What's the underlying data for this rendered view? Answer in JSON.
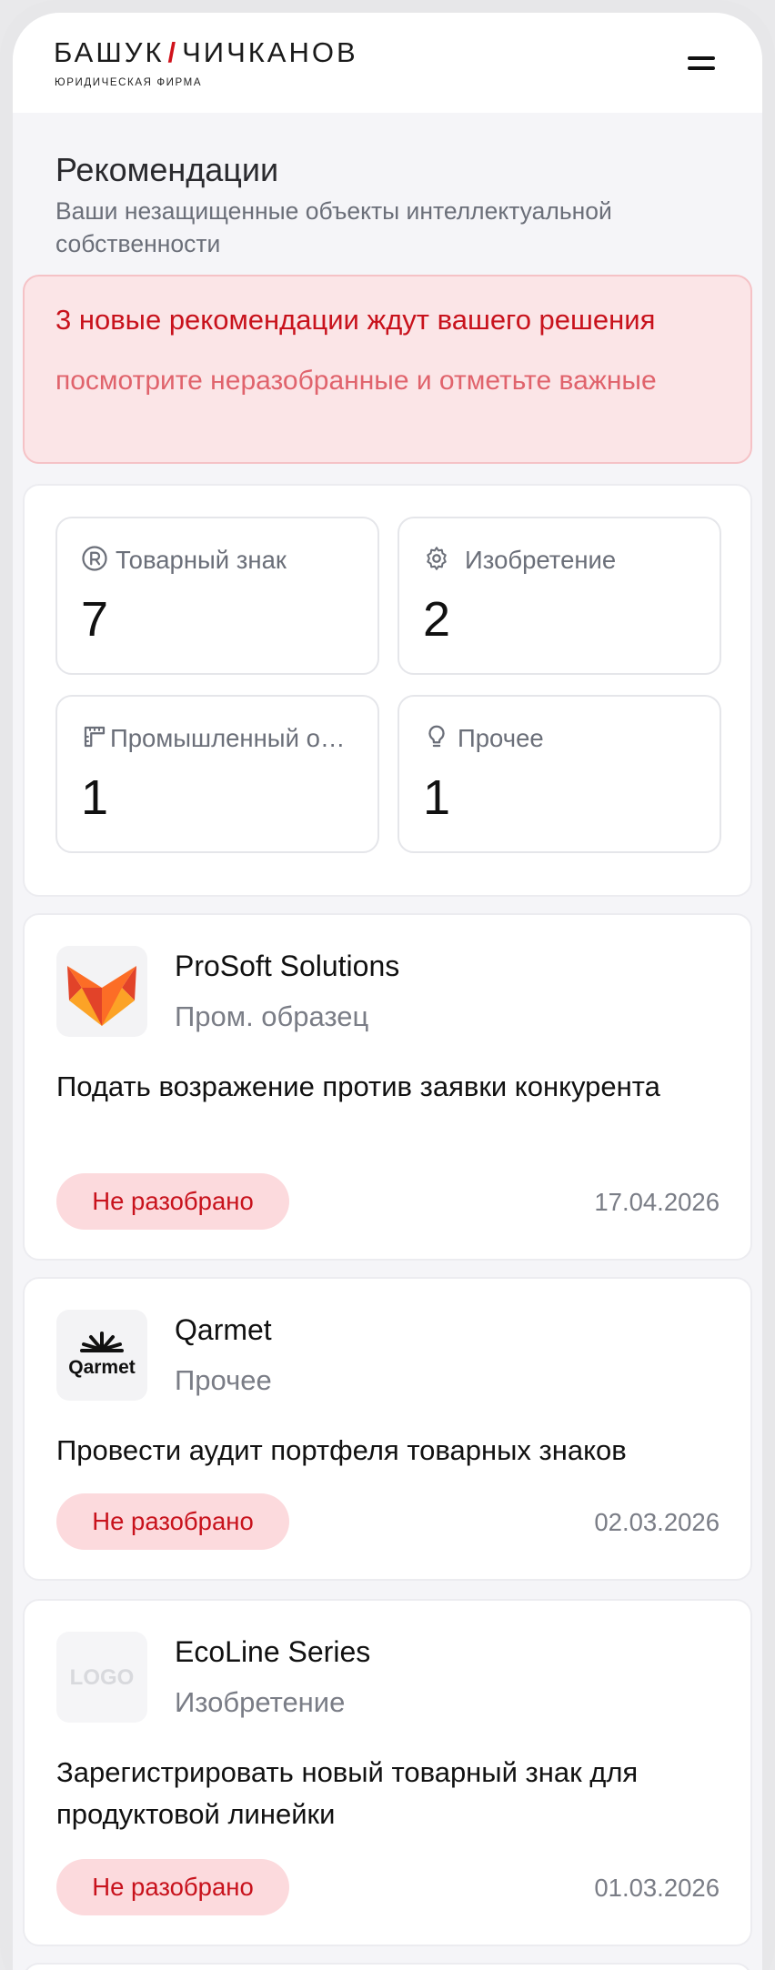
{
  "header": {
    "brand_left": "БАШУК",
    "brand_slash": "/",
    "brand_right": "ЧИЧКАНОВ",
    "brand_sub": "ЮРИДИЧЕСКАЯ ФИРМА"
  },
  "page": {
    "title": "Рекомендации",
    "subtitle": "Ваши незащищенные объекты интеллектуальной собственности"
  },
  "alert": {
    "title": "3 новые рекомендации ждут вашего решения",
    "text": "посмотрите неразобранные и отметьте важные"
  },
  "stats": [
    {
      "label": "Товарный знак",
      "value": "7",
      "icon": "registered-icon"
    },
    {
      "label": "Изобретение",
      "value": "2",
      "icon": "gear-icon"
    },
    {
      "label": "Промышленный образец",
      "value": "1",
      "icon": "ruler-icon"
    },
    {
      "label": "Прочее",
      "value": "1",
      "icon": "lightbulb-icon"
    }
  ],
  "recommendations": [
    {
      "company": "ProSoft Solutions",
      "type": "Пром. образец",
      "description": "Подать возражение против заявки конкурента",
      "status": "Не разобрано",
      "date": "17.04.2026",
      "logo": "fox-logo"
    },
    {
      "company": "Qarmet",
      "type": "Прочее",
      "description": "Провести аудит портфеля товарных знаков",
      "status": "Не разобрано",
      "date": "02.03.2026",
      "logo": "qarmet-logo",
      "logo_text": "Qarmet"
    },
    {
      "company": "EcoLine Series",
      "type": "Изобретение",
      "description": "Зарегистрировать новый товарный знак для продуктовой линейки",
      "status": "Не разобрано",
      "date": "01.03.2026",
      "logo": "placeholder-logo",
      "logo_text": "LOGO"
    }
  ],
  "colors": {
    "accent_red": "#c8121c",
    "alert_bg": "#fbe5e7",
    "badge_bg": "#fcdadd"
  }
}
